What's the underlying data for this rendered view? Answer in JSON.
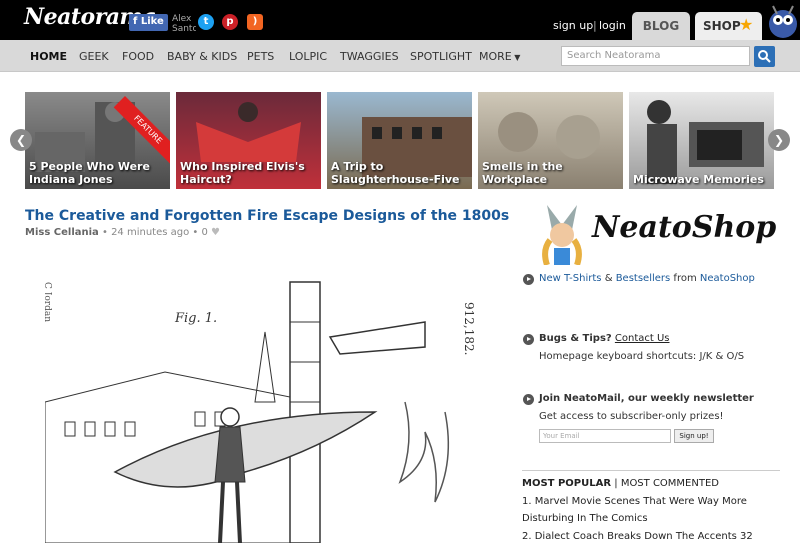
{
  "header": {
    "logo": "Neatorama",
    "fb_like": "Like",
    "fb_name": "Alex Santo",
    "sign_up": "sign up",
    "separator": "|",
    "login": "login",
    "tab_blog": "BLOG",
    "tab_shop": "SHOP"
  },
  "nav": {
    "items": [
      "HOME",
      "GEEK",
      "FOOD",
      "BABY & KIDS",
      "PETS",
      "LOLPIC",
      "TWAGGIES",
      "SPOTLIGHT",
      "MORE"
    ],
    "search_placeholder": "Search Neatorama"
  },
  "carousel": {
    "feature_badge": "FEATURE",
    "slides": [
      {
        "caption": "5 People Who Were Indiana Jones"
      },
      {
        "caption": "Who Inspired Elvis's Haircut?"
      },
      {
        "caption": "A Trip to Slaughterhouse-Five"
      },
      {
        "caption": "Smells in the Workplace"
      },
      {
        "caption": "Microwave Memories"
      }
    ]
  },
  "article": {
    "title": "The Creative and Forgotten Fire Escape Designs of the 1800s",
    "author": "Miss Cellania",
    "time": "24 minutes ago",
    "likes": "0",
    "patent_number": "912,182.",
    "fig_label": "Fig. 1."
  },
  "sidebar": {
    "shop_name": "NeatoShop",
    "shop_line_a": "New T-Shirts",
    "shop_line_amp": "&",
    "shop_line_b": "Bestsellers",
    "shop_line_from": "from",
    "shop_line_c": "NeatoShop",
    "bugs_label": "Bugs & Tips?",
    "contact_link": "Contact Us",
    "shortcuts": "Homepage keyboard shortcuts: J/K & O/S",
    "newsletter_title": "Join NeatoMail, our weekly newsletter",
    "newsletter_desc": "Get access to subscriber-only prizes!",
    "email_placeholder": "Your Email",
    "signup_button": "Sign up!",
    "most_popular": "MOST POPULAR",
    "tab_sep": "|",
    "most_commented": "MOST COMMENTED",
    "popular_items": [
      "1. Marvel Movie Scenes That Were Way More Disturbing In The Comics",
      "2. Dialect Coach Breaks Down The Accents 32"
    ]
  },
  "colors": {
    "link": "#1b5a9a",
    "nav_bg": "#d9d9d9",
    "topbar": "#000000",
    "search_button": "#2c6fb6"
  }
}
